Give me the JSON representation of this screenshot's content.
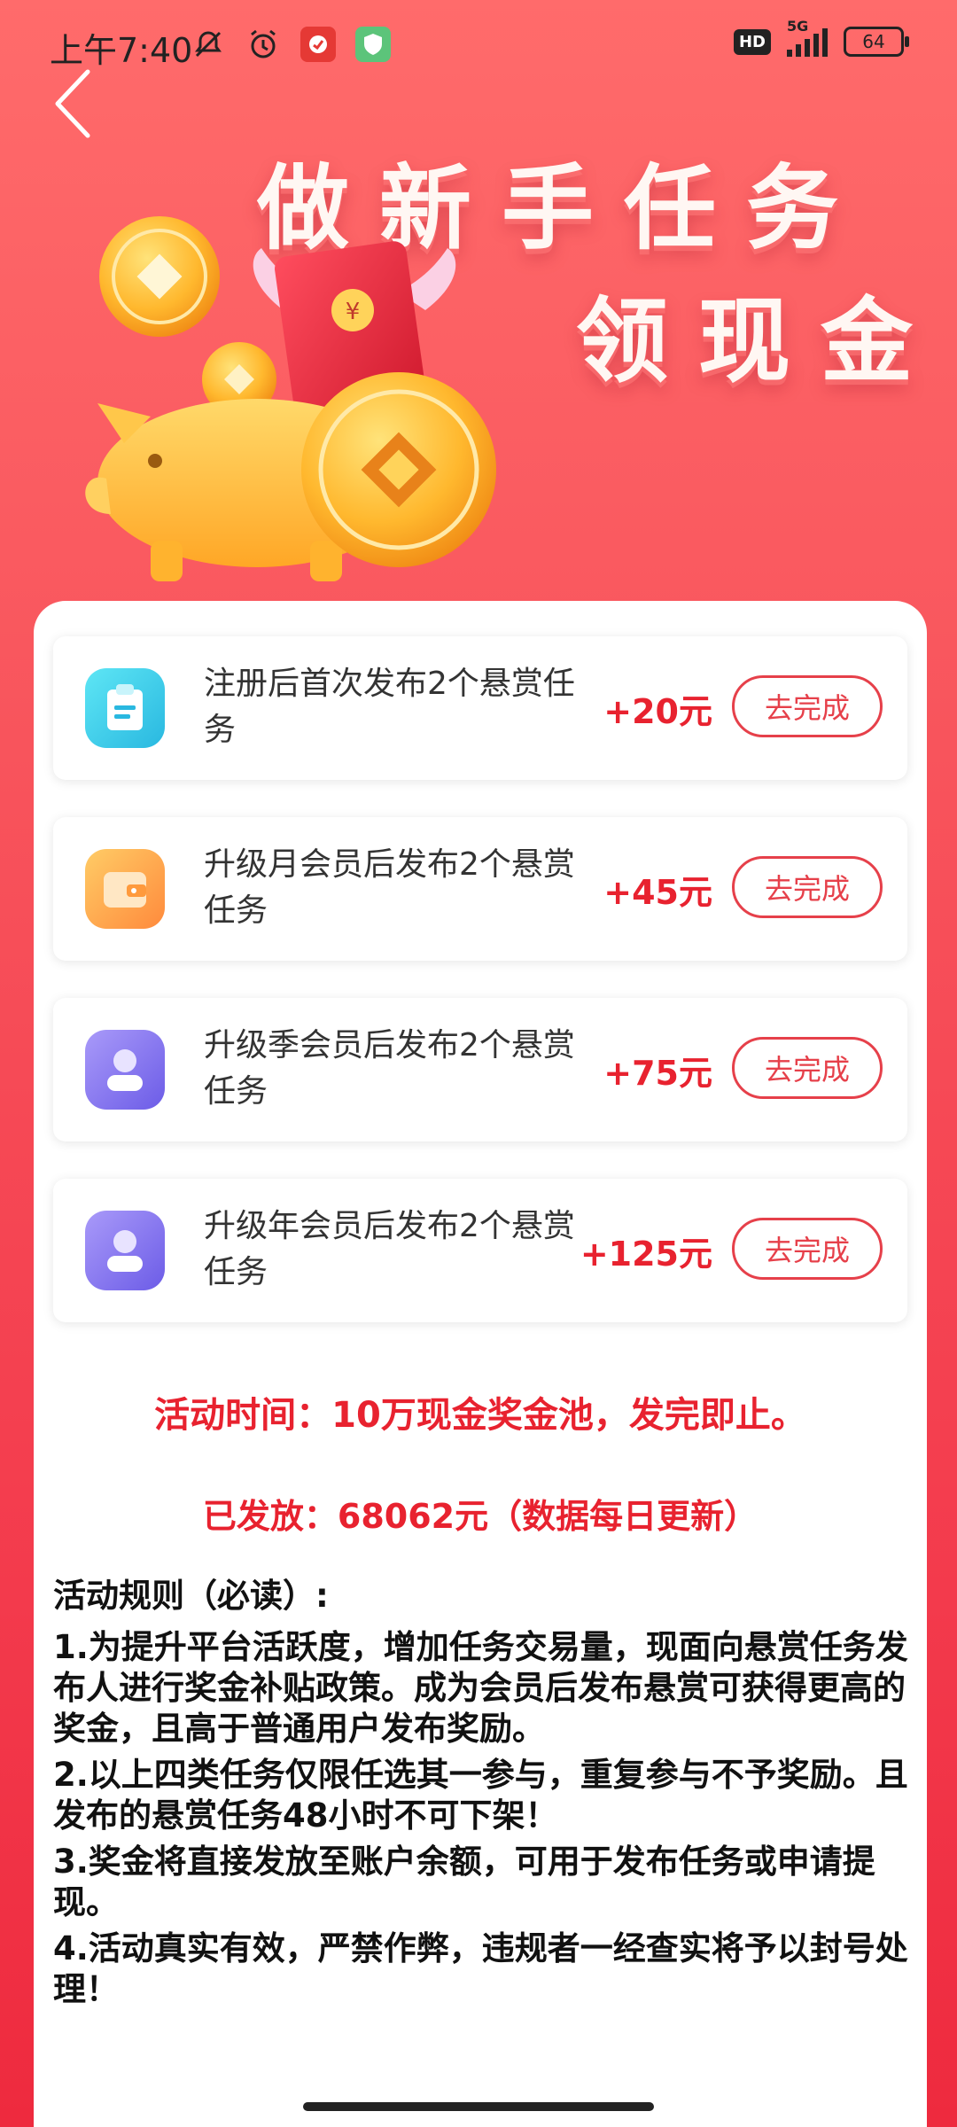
{
  "status_bar": {
    "time": "上午7:40",
    "network": "5G",
    "hd": "HD",
    "battery": "64"
  },
  "hero": {
    "title_line1": "做新手任务",
    "title_line2": "领现金"
  },
  "tasks": [
    {
      "text": "注册后首次发布2个悬赏任务",
      "reward": "+20元",
      "button": "去完成",
      "icon": "clipboard-icon",
      "icon_color": "#3fd0e8"
    },
    {
      "text": "升级月会员后发布2个悬赏任务",
      "reward": "+45元",
      "button": "去完成",
      "icon": "wallet-icon",
      "icon_color": "#ff9a3c"
    },
    {
      "text": "升级季会员后发布2个悬赏任务",
      "reward": "+75元",
      "button": "去完成",
      "icon": "user-icon",
      "icon_color": "#8a7cf4"
    },
    {
      "text": "升级年会员后发布2个悬赏任务",
      "reward": "+125元",
      "button": "去完成",
      "icon": "user-icon",
      "icon_color": "#8a7cf4"
    }
  ],
  "notices": {
    "activity_time": "活动时间：10万现金奖金池，发完即止。",
    "issued": "已发放：68062元（数据每日更新）"
  },
  "rules": {
    "title": "活动规则（必读）:",
    "items": [
      "1.为提升平台活跃度，增加任务交易量，现面向悬赏任务发布人进行奖金补贴政策。成为会员后发布悬赏可获得更高的奖金，且高于普通用户发布奖励。",
      "2.以上四类任务仅限任选其一参与，重复参与不予奖励。且发布的悬赏任务48小时不可下架！",
      "3.奖金将直接发放至账户余额，可用于发布任务或申请提现。",
      "4.活动真实有效，严禁作弊，违规者一经查实将予以封号处理！"
    ]
  },
  "colors": {
    "accent_red": "#e8222f",
    "background_top": "#ff6b6b",
    "background_bottom": "#ee2a3e"
  }
}
